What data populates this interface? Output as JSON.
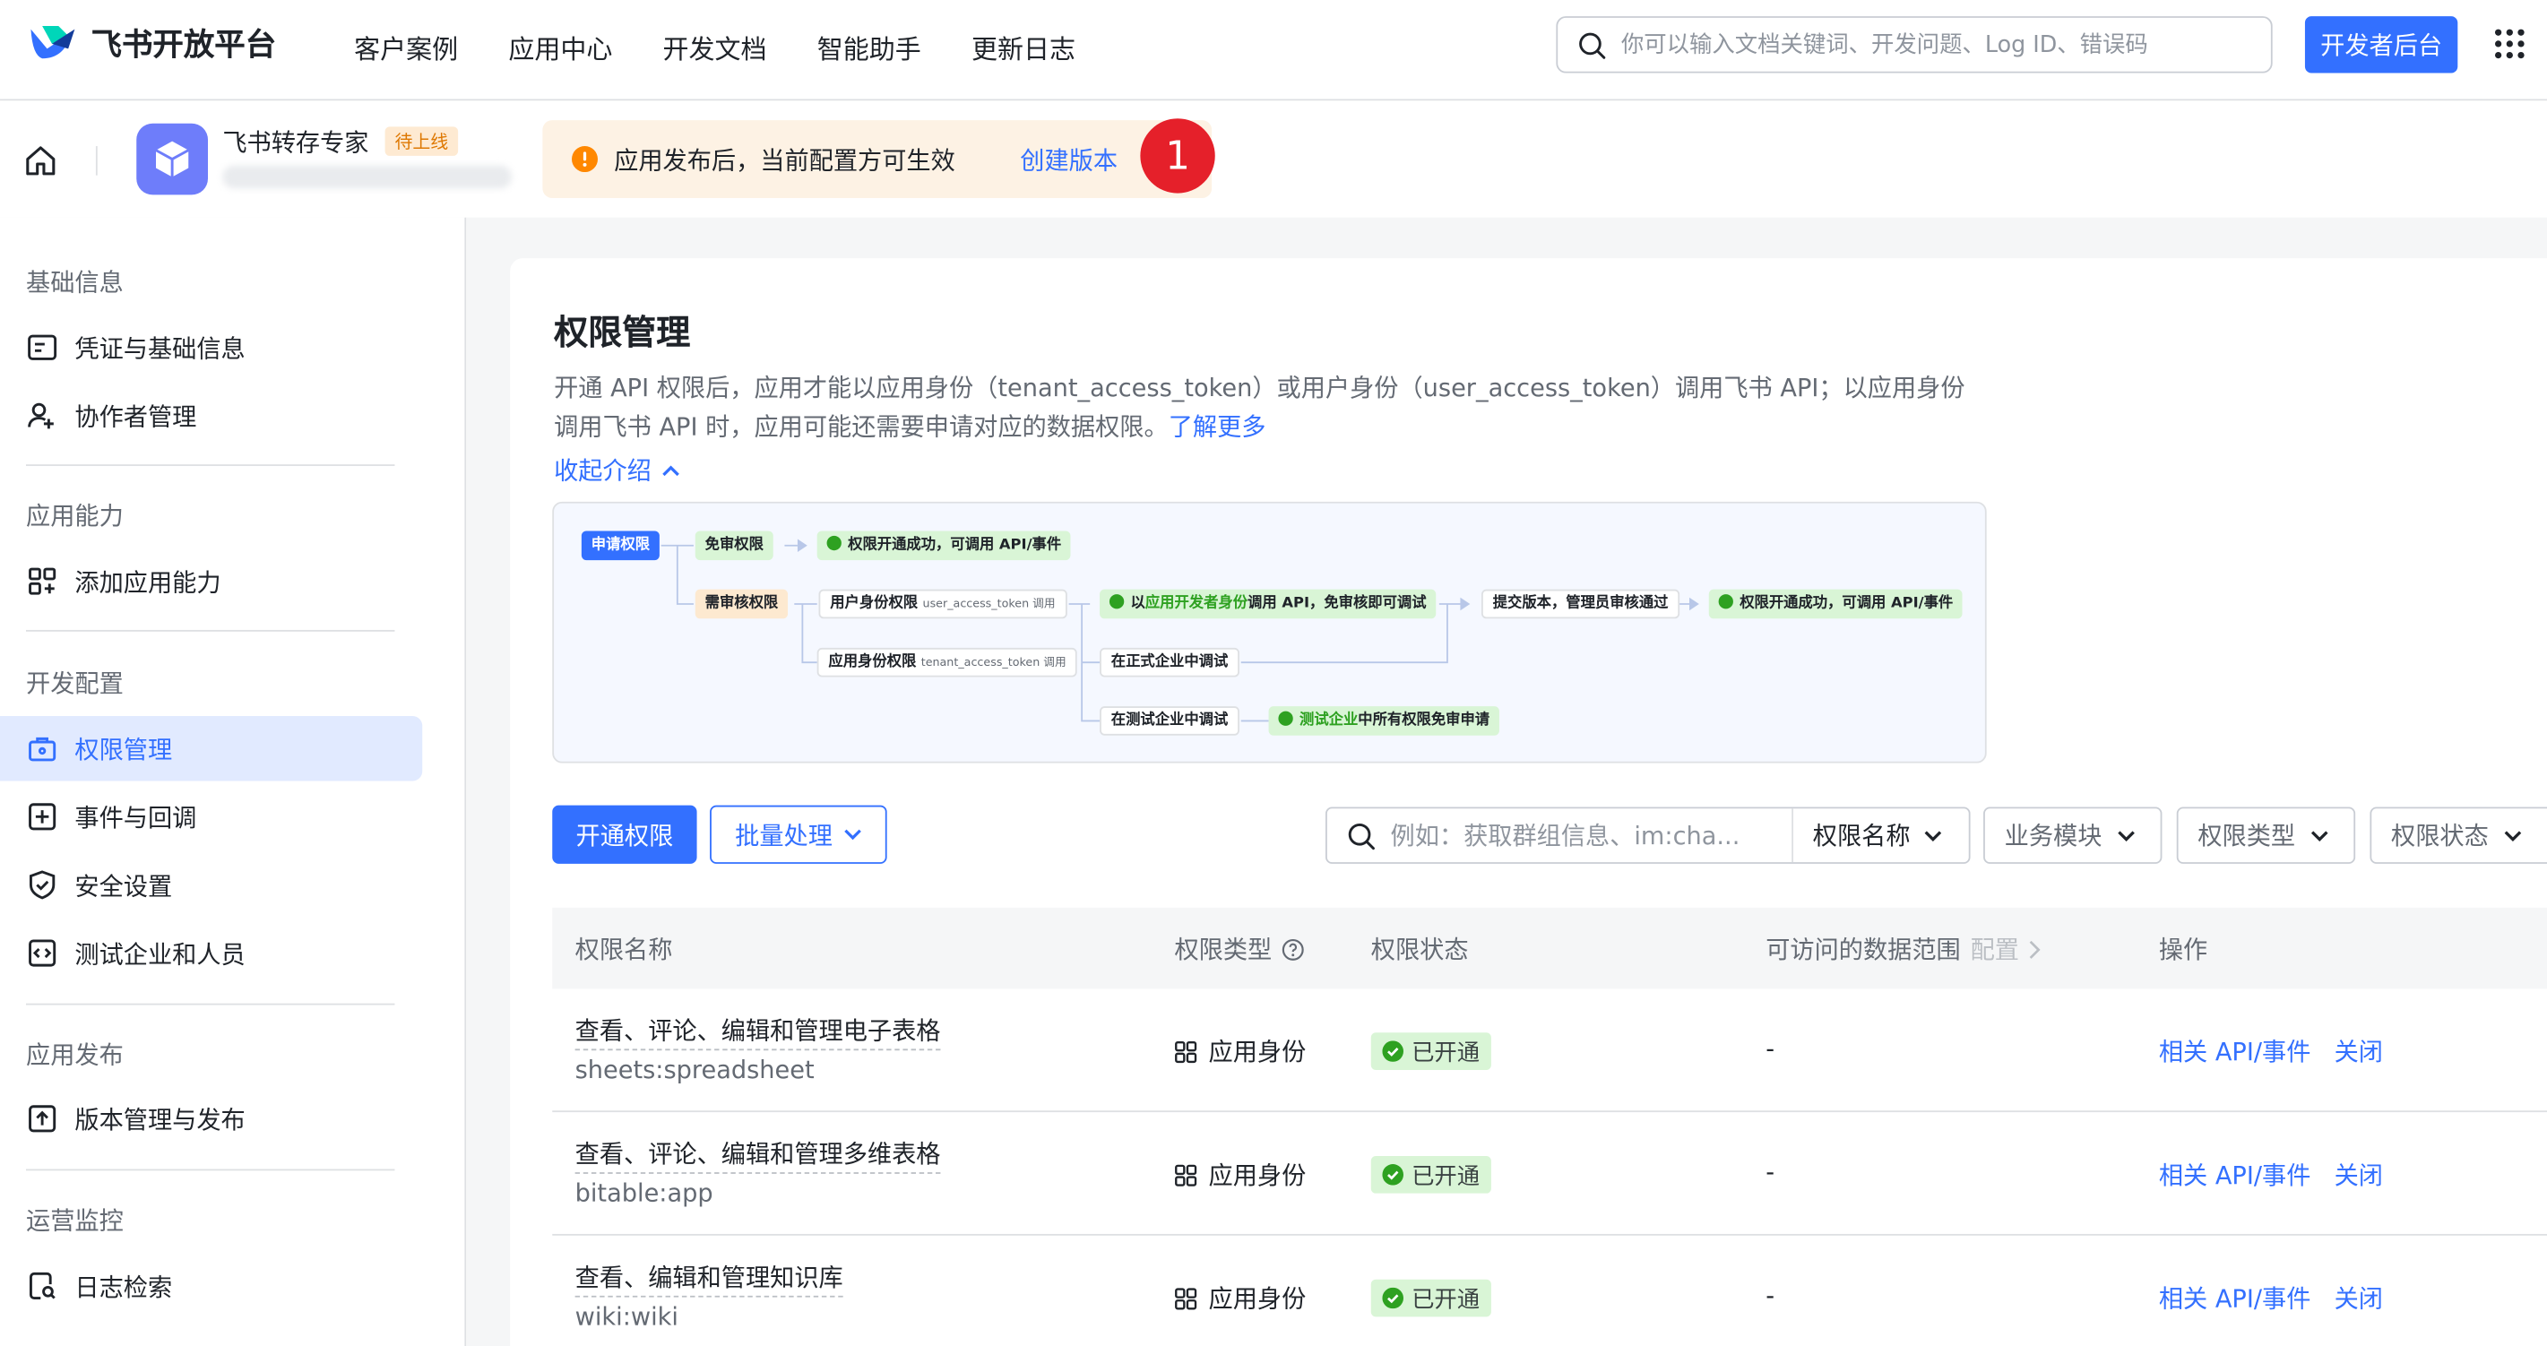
{
  "topnav": {
    "brand": "飞书开放平台",
    "links": [
      "客户案例",
      "应用中心",
      "开发文档",
      "智能助手",
      "更新日志"
    ],
    "search_placeholder": "你可以输入文档关键词、开发问题、Log ID、错误码",
    "dev_console": "开发者后台"
  },
  "appbar": {
    "app_name": "飞书转存专家",
    "app_status": "待上线",
    "notice_text": "应用发布后，当前配置方可生效",
    "notice_link": "创建版本",
    "marker": "1"
  },
  "sidebar": {
    "sections": [
      {
        "title": "基础信息",
        "items": [
          "凭证与基础信息",
          "协作者管理"
        ]
      },
      {
        "title": "应用能力",
        "items": [
          "添加应用能力"
        ]
      },
      {
        "title": "开发配置",
        "items": [
          "权限管理",
          "事件与回调",
          "安全设置",
          "测试企业和人员"
        ]
      },
      {
        "title": "应用发布",
        "items": [
          "版本管理与发布"
        ]
      },
      {
        "title": "运营监控",
        "items": [
          "日志检索"
        ]
      }
    ],
    "active": "权限管理"
  },
  "main": {
    "title": "权限管理",
    "desc_line1": "开通 API 权限后，应用才能以应用身份（tenant_access_token）或用户身份（user_access_token）调用飞书 API；以应用身份",
    "desc_line2": "调用飞书 API 时，应用可能还需要申请对应的数据权限。",
    "learn_more": "了解更多",
    "collapse": "收起介绍",
    "flow": {
      "apply": "申请权限",
      "free": "免审权限",
      "free_result": "权限开通成功，可调用 API/事件",
      "review": "需审核权限",
      "user_perm": "用户身份权限",
      "user_token": "user_access_token 调用",
      "dev_debug_pre": "以",
      "dev_debug_hl": "应用开发者身份",
      "dev_debug_post": "调用 API，免审核即可调试",
      "submit": "提交版本，管理员审核通过",
      "final_result": "权限开通成功，可调用 API/事件",
      "app_perm": "应用身份权限",
      "app_token": "tenant_access_token 调用",
      "prod_debug": "在正式企业中调试",
      "test_debug": "在测试企业中调试",
      "test_free_hl": "测试企业",
      "test_free_post": "中所有权限免审申请"
    },
    "toolbar": {
      "open_btn": "开通权限",
      "batch_btn": "批量处理",
      "search_placeholder": "例如：获取群组信息、im:cha...",
      "search_field": "权限名称",
      "filters": [
        "业务模块",
        "权限类型",
        "权限状态"
      ]
    },
    "table": {
      "headers": {
        "name": "权限名称",
        "type": "权限类型",
        "status": "权限状态",
        "scope": "可访问的数据范围",
        "scope_config": "配置",
        "action": "操作"
      },
      "rows": [
        {
          "name": "查看、评论、编辑和管理电子表格",
          "code": "sheets:spreadsheet",
          "type": "应用身份",
          "status": "已开通",
          "scope": "-",
          "related": "相关 API/事件",
          "close": "关闭"
        },
        {
          "name": "查看、评论、编辑和管理多维表格",
          "code": "bitable:app",
          "type": "应用身份",
          "status": "已开通",
          "scope": "-",
          "related": "相关 API/事件",
          "close": "关闭"
        },
        {
          "name": "查看、编辑和管理知识库",
          "code": "wiki:wiki",
          "type": "应用身份",
          "status": "已开通",
          "scope": "-",
          "related": "相关 API/事件",
          "close": "关闭"
        }
      ]
    }
  },
  "colors": {
    "primary": "#3370ff",
    "success": "#2ea121",
    "warning": "#ff8800",
    "marker": "#e5202a"
  },
  "icons": [
    "feishu-logo-icon",
    "search-icon",
    "apps-grid-icon",
    "home-icon",
    "app-cube-icon",
    "warning-icon",
    "chevron-up-icon",
    "chevron-down-icon",
    "help-icon",
    "check-circle-icon",
    "grid-type-icon"
  ]
}
